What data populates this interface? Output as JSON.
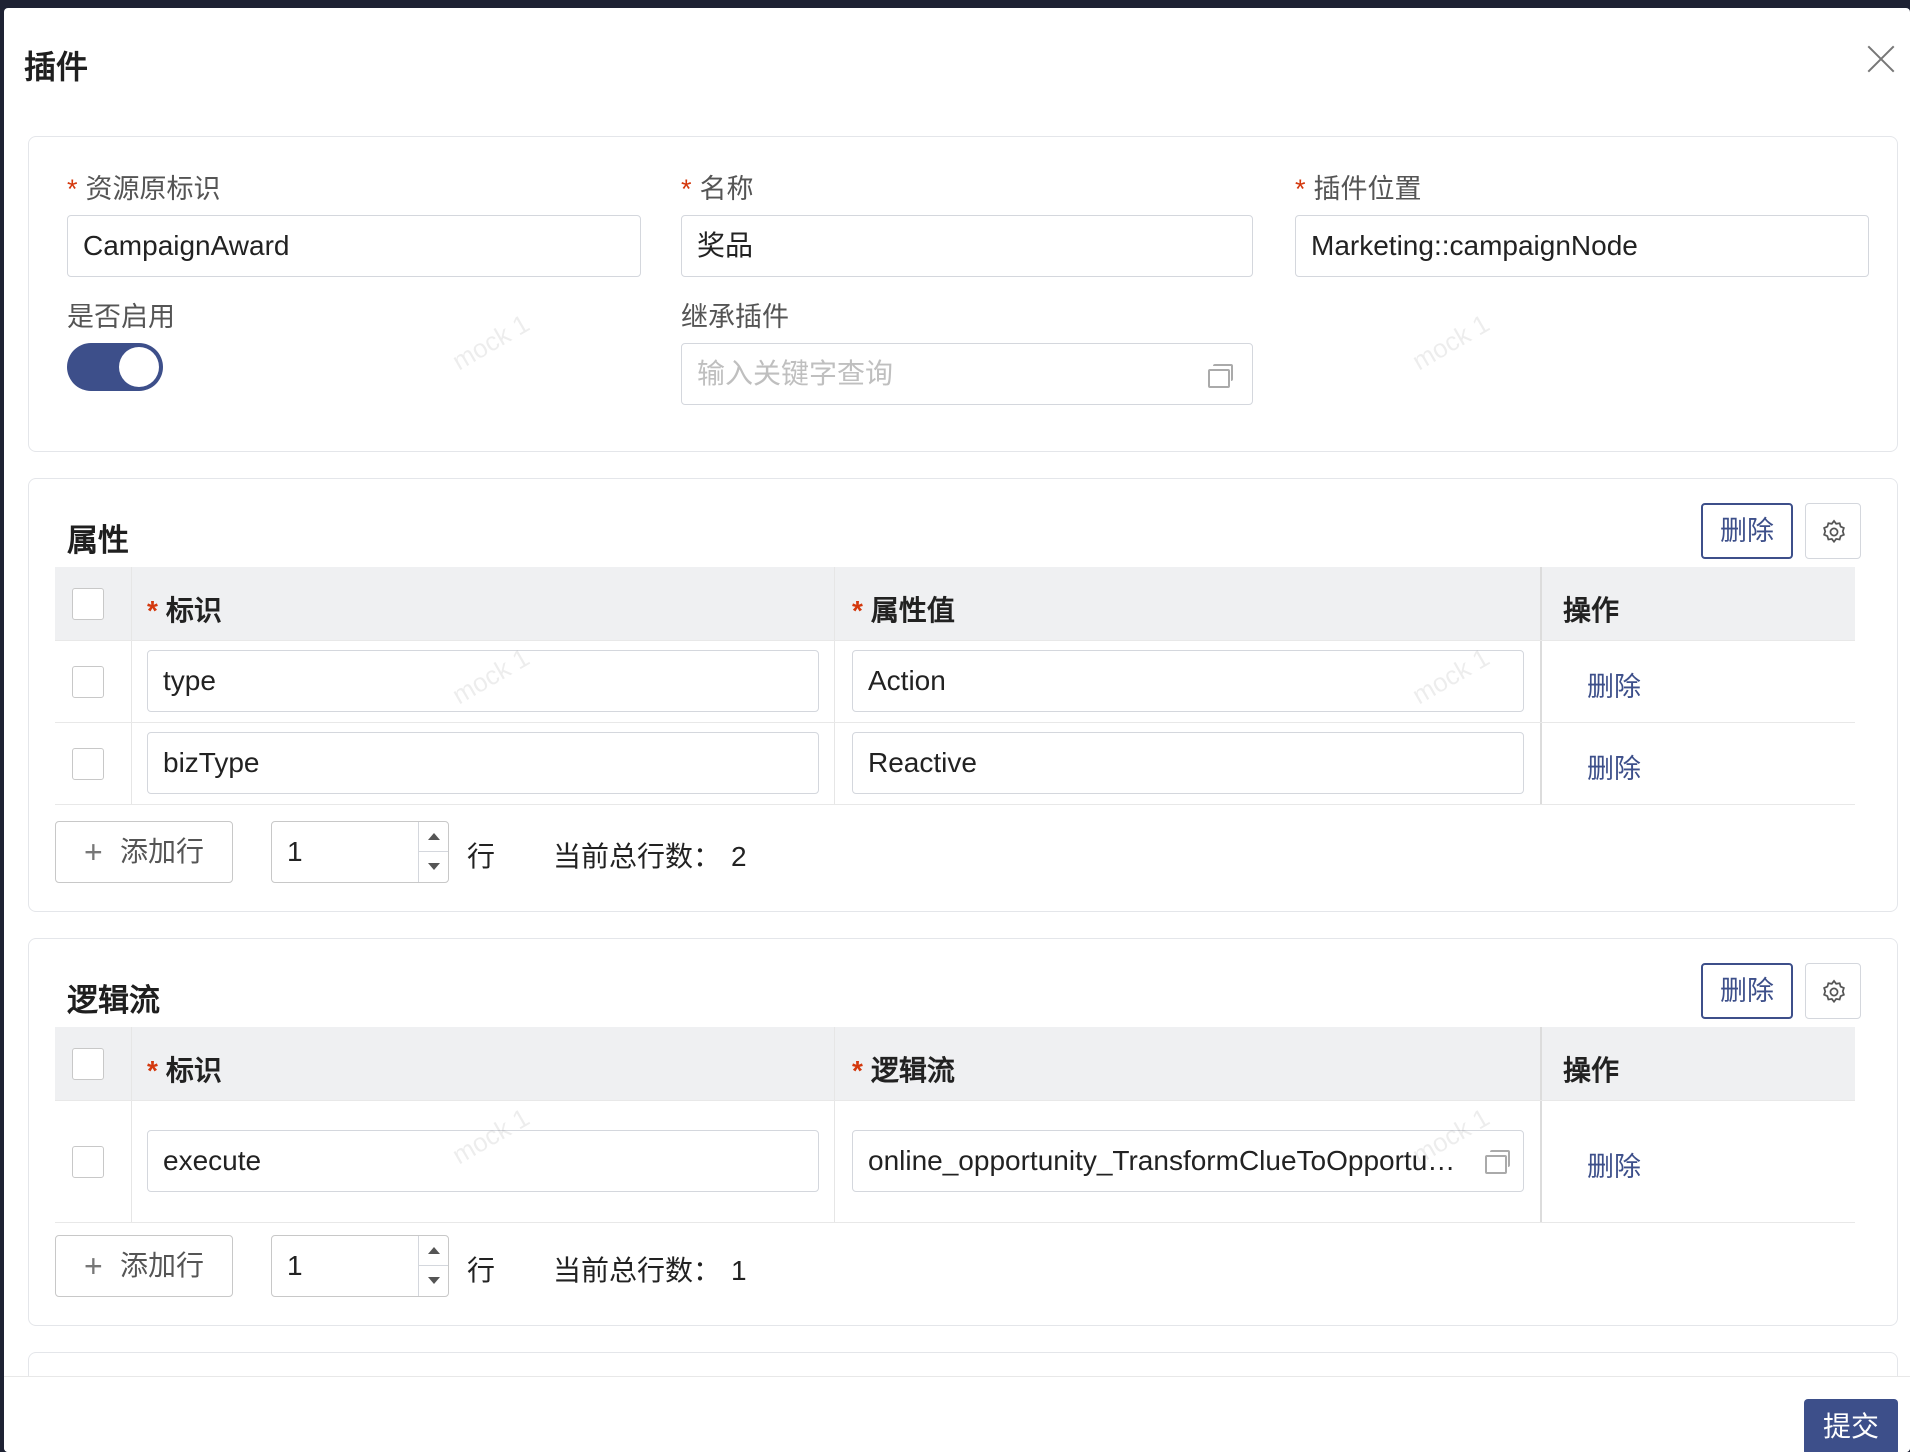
{
  "modal": {
    "title": "插件",
    "close_icon": "close-icon"
  },
  "basic": {
    "resource_id_label": "资源原标识",
    "resource_id_value": "CampaignAward",
    "name_label": "名称",
    "name_value": "奖品",
    "position_label": "插件位置",
    "position_value": "Marketing::campaignNode",
    "enabled_label": "是否启用",
    "enabled": true,
    "inherit_label": "继承插件",
    "inherit_placeholder": "输入关键字查询",
    "required_mark": "*"
  },
  "attributes": {
    "title": "属性",
    "delete_label": "删除",
    "columns": {
      "id": "标识",
      "value": "属性值",
      "ops": "操作"
    },
    "rows": [
      {
        "id": "type",
        "value": "Action",
        "op": "删除"
      },
      {
        "id": "bizType",
        "value": "Reactive",
        "op": "删除"
      }
    ],
    "add_row_label": "添加行",
    "add_count": "1",
    "row_unit": "行",
    "total_label": "当前总行数：",
    "total": "2"
  },
  "logic": {
    "title": "逻辑流",
    "delete_label": "删除",
    "columns": {
      "id": "标识",
      "value": "逻辑流",
      "ops": "操作"
    },
    "rows": [
      {
        "id": "execute",
        "value": "online_opportunity_TransformClueToOpportunity",
        "op": "删除"
      }
    ],
    "add_row_label": "添加行",
    "add_count": "1",
    "row_unit": "行",
    "total_label": "当前总行数：",
    "total": "1"
  },
  "footer": {
    "submit_label": "提交"
  },
  "watermark": "mock 1",
  "colors": {
    "primary": "#3d4f8a",
    "required": "#d4380d",
    "header_bg": "#eff0f2"
  }
}
